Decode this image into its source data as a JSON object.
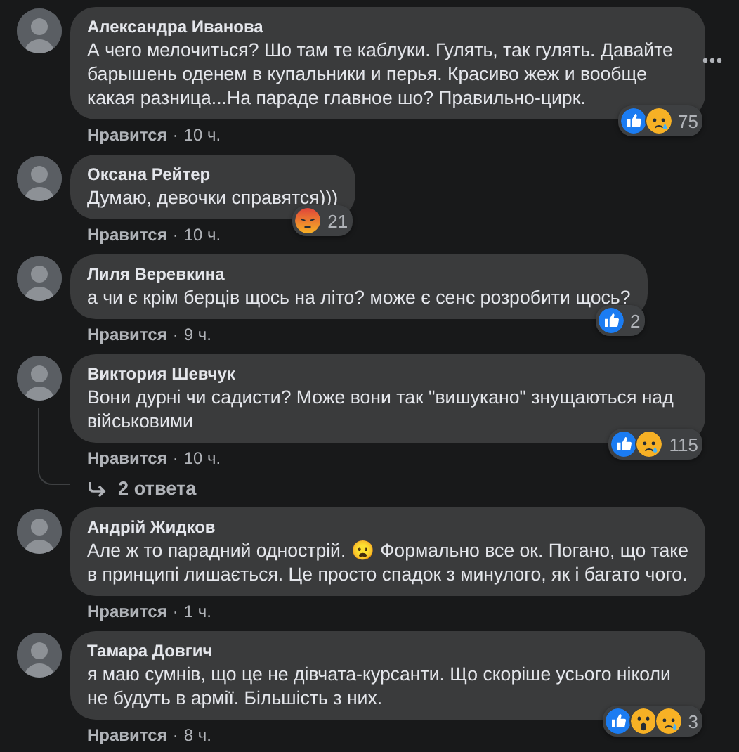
{
  "comments": [
    {
      "author": "Александра Иванова",
      "text": "А чего мелочиться? Шо там те каблуки. Гулять, так гулять. Давайте барышень оденем в купальники и перья. Красиво жеж и вообще какая разница...На параде главное шо? Правильно-цирк.",
      "reactions": [
        {
          "kind": "like"
        },
        {
          "kind": "sad"
        }
      ],
      "reaction_count": "75",
      "like_label": "Нравится",
      "separator": "·",
      "time": "10 ч.",
      "hovered": true
    },
    {
      "author": "Оксана Рейтер",
      "text": "Думаю, девочки справятся)))",
      "reactions": [
        {
          "kind": "angry"
        }
      ],
      "reaction_count": "21",
      "like_label": "Нравится",
      "separator": "·",
      "time": "10 ч.",
      "hovered": false
    },
    {
      "author": "Лиля Веревкина",
      "text": "а чи є крім берців щось на літо? може є сенс розробити щось?",
      "reactions": [
        {
          "kind": "like"
        }
      ],
      "reaction_count": "2",
      "like_label": "Нравится",
      "separator": "·",
      "time": "9 ч.",
      "hovered": false
    },
    {
      "author": "Виктория Шевчук",
      "text": "Вони дурні чи садисти? Може вони так \"вишукано\" знущаються над військовими",
      "reactions": [
        {
          "kind": "like"
        },
        {
          "kind": "sad"
        }
      ],
      "reaction_count": "115",
      "like_label": "Нравится",
      "separator": "·",
      "time": "10 ч.",
      "hovered": false,
      "replies": "2 ответа"
    },
    {
      "author": "Андрій Жидков",
      "text": "Але ж то парадний однострій. 😦 Формально все ок. Погано, що таке в принципі лишається. Це просто спадок з минулого, як і багато чого.",
      "like_label": "Нравится",
      "separator": "·",
      "time": "1 ч.",
      "hovered": false
    },
    {
      "author": "Тамара Довгич",
      "text": "я маю сумнів, що це не дівчата-курсанти. Що скоріше усього ніколи не будуть в армії. Більшість з них.",
      "reactions": [
        {
          "kind": "like"
        },
        {
          "kind": "wow"
        },
        {
          "kind": "sad"
        }
      ],
      "reaction_count": "3",
      "like_label": "Нравится",
      "separator": "·",
      "time": "8 ч.",
      "hovered": false
    }
  ]
}
